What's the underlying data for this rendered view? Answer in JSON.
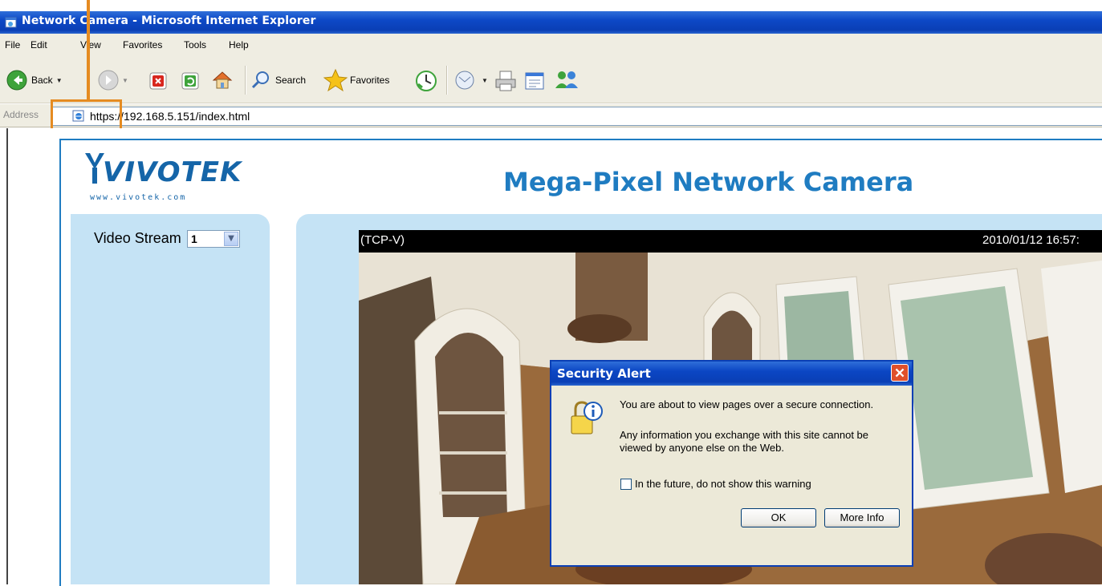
{
  "window": {
    "title": "Network Camera - Microsoft Internet Explorer"
  },
  "menu": [
    "File",
    "Edit",
    "View",
    "Favorites",
    "Tools",
    "Help"
  ],
  "toolbar": {
    "back": "Back",
    "search": "Search",
    "favorites": "Favorites"
  },
  "address": {
    "label": "Address",
    "url": "https://192.168.5.151/index.html"
  },
  "page": {
    "logo": "VIVOTEK",
    "logo_url": "www.vivotek.com",
    "heading": "Mega-Pixel Network Camera",
    "video_stream_label": "Video Stream",
    "video_stream_value": "1"
  },
  "video": {
    "protocol": "(TCP-V)",
    "timestamp": "2010/01/12 16:57:"
  },
  "dialog": {
    "title": "Security Alert",
    "message1": "You are about to view pages over a secure connection.",
    "message2": "Any information you exchange with this site cannot be viewed by anyone else on the Web.",
    "checkbox_label": "In the future, do not show this warning",
    "ok": "OK",
    "more_info": "More Info"
  },
  "colors": {
    "accent": "#1f7cc1",
    "panel": "#c5e3f5",
    "highlight": "#e58b21"
  }
}
